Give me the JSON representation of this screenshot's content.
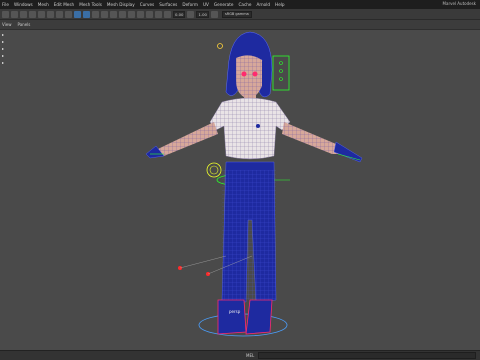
{
  "app": {
    "title": "Marvel Autodesk"
  },
  "menu": [
    "File",
    "Windows",
    "Mesh",
    "Edit Mesh",
    "Mesh Tools",
    "Mesh Display",
    "Curves",
    "Surfaces",
    "Deform",
    "UV",
    "Generate",
    "Cache",
    "Arnold",
    "Help"
  ],
  "toolbar": {
    "field1": "0.00",
    "field2": "1.00",
    "colorspace": "sRGB gamma"
  },
  "panel_menu": [
    "View",
    "Panels"
  ],
  "viewport": {
    "camera": "persp",
    "colors": {
      "mesh": "#1e2aa0",
      "wire": "#5a6bff",
      "shirt": "#e9e3e6",
      "joint": "#2aff2a",
      "skin": "#d7a89a",
      "accent": "#ff2a6e"
    }
  },
  "command_line": {
    "label": "MEL"
  }
}
